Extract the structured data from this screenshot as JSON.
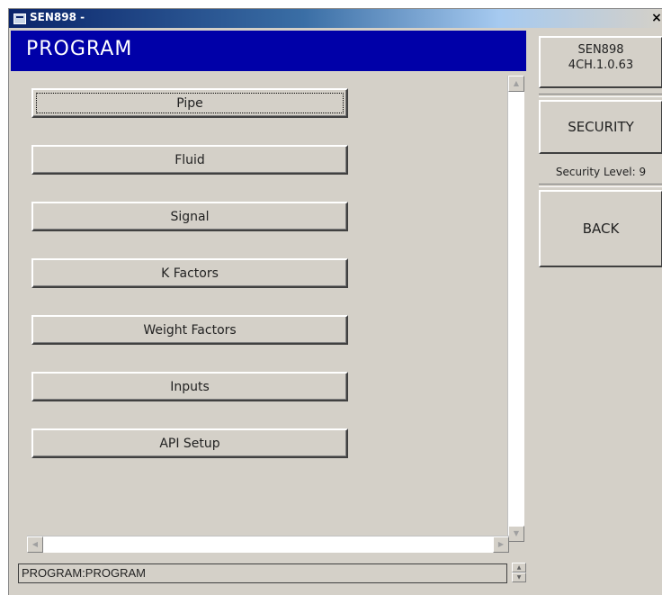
{
  "window": {
    "title": "SEN898 -",
    "close_glyph": "×"
  },
  "header": {
    "title": "PROGRAM"
  },
  "menu": {
    "items": [
      {
        "label": "Pipe"
      },
      {
        "label": "Fluid"
      },
      {
        "label": "Signal"
      },
      {
        "label": "K Factors"
      },
      {
        "label": "Weight Factors"
      },
      {
        "label": "Inputs"
      },
      {
        "label": "API Setup"
      }
    ]
  },
  "side": {
    "device_name": "SEN898",
    "version": "4CH.1.0.63",
    "security_button": "SECURITY",
    "security_level": "Security Level: 9",
    "back_button": "BACK"
  },
  "status": {
    "text": "PROGRAM:PROGRAM"
  },
  "icons": {
    "scroll_up": "up-arrow-icon",
    "scroll_down": "down-arrow-icon",
    "scroll_left": "left-arrow-icon",
    "scroll_right": "right-arrow-icon"
  },
  "colors": {
    "header_bg": "#0000a8",
    "window_bg": "#d4d0c8",
    "titlebar": "#0a246a"
  }
}
